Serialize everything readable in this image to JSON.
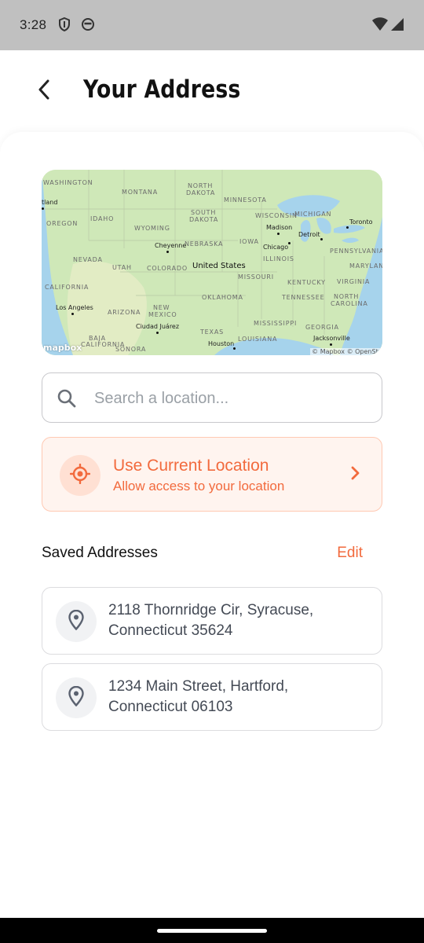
{
  "status_bar": {
    "time": "3:28",
    "icons": [
      "shield-icon",
      "face-icon",
      "wifi-icon",
      "signal-icon"
    ]
  },
  "header": {
    "back_icon": "chevron-left-icon",
    "title": "Your Address"
  },
  "map": {
    "logo": "mapbox",
    "attribution": "© Mapbox © OpenStr",
    "country_label": "United States",
    "state_labels": [
      {
        "text": "WASHINGTON"
      },
      {
        "text": "MONTANA"
      },
      {
        "text": "NORTH"
      },
      {
        "text": "DAKOTA"
      },
      {
        "text": "MINNESOTA"
      },
      {
        "text": "OREGON"
      },
      {
        "text": "IDAHO"
      },
      {
        "text": "SOUTH"
      },
      {
        "text": "DAKOTA"
      },
      {
        "text": "WISCONSIN"
      },
      {
        "text": "MICHIGAN"
      },
      {
        "text": "WYOMING"
      },
      {
        "text": "NEBRASKA"
      },
      {
        "text": "IOWA"
      },
      {
        "text": "NEVADA"
      },
      {
        "text": "UTAH"
      },
      {
        "text": "COLORADO"
      },
      {
        "text": "ILLINOIS"
      },
      {
        "text": "PENNSYLVANIA"
      },
      {
        "text": "MARYLAND"
      },
      {
        "text": "CALIFORNIA"
      },
      {
        "text": "MISSOURI"
      },
      {
        "text": "KENTUCKY"
      },
      {
        "text": "VIRGINIA"
      },
      {
        "text": "OKLAHOMA"
      },
      {
        "text": "TENNESSEE"
      },
      {
        "text": "NORTH"
      },
      {
        "text": "CAROLINA"
      },
      {
        "text": "ARIZONA"
      },
      {
        "text": "NEW"
      },
      {
        "text": "MEXICO"
      },
      {
        "text": "MISSISSIPPI"
      },
      {
        "text": "GEORGIA"
      },
      {
        "text": "TEXAS"
      },
      {
        "text": "LOUISIANA"
      },
      {
        "text": "BAJA"
      },
      {
        "text": "CALIFORNIA"
      },
      {
        "text": "SONORA"
      }
    ],
    "cities": [
      {
        "text": "tland"
      },
      {
        "text": "Toronto"
      },
      {
        "text": "Madison"
      },
      {
        "text": "Detroit"
      },
      {
        "text": "Cheyenne"
      },
      {
        "text": "Chicago"
      },
      {
        "text": "Los Angeles"
      },
      {
        "text": "Ciudad Juárez"
      },
      {
        "text": "Houston"
      },
      {
        "text": "Jacksonville"
      }
    ]
  },
  "search": {
    "placeholder": "Search a location...",
    "value": ""
  },
  "current_location": {
    "title": "Use Current Location",
    "subtitle": "Allow access to your location",
    "accent": "#f26a3d"
  },
  "saved": {
    "title": "Saved Addresses",
    "edit_label": "Edit",
    "addresses": [
      {
        "line1": "2118 Thornridge Cir, Syracuse,",
        "line2": "Connecticut 35624"
      },
      {
        "line1": "1234 Main Street, Hartford,",
        "line2": "Connecticut 06103"
      }
    ]
  }
}
